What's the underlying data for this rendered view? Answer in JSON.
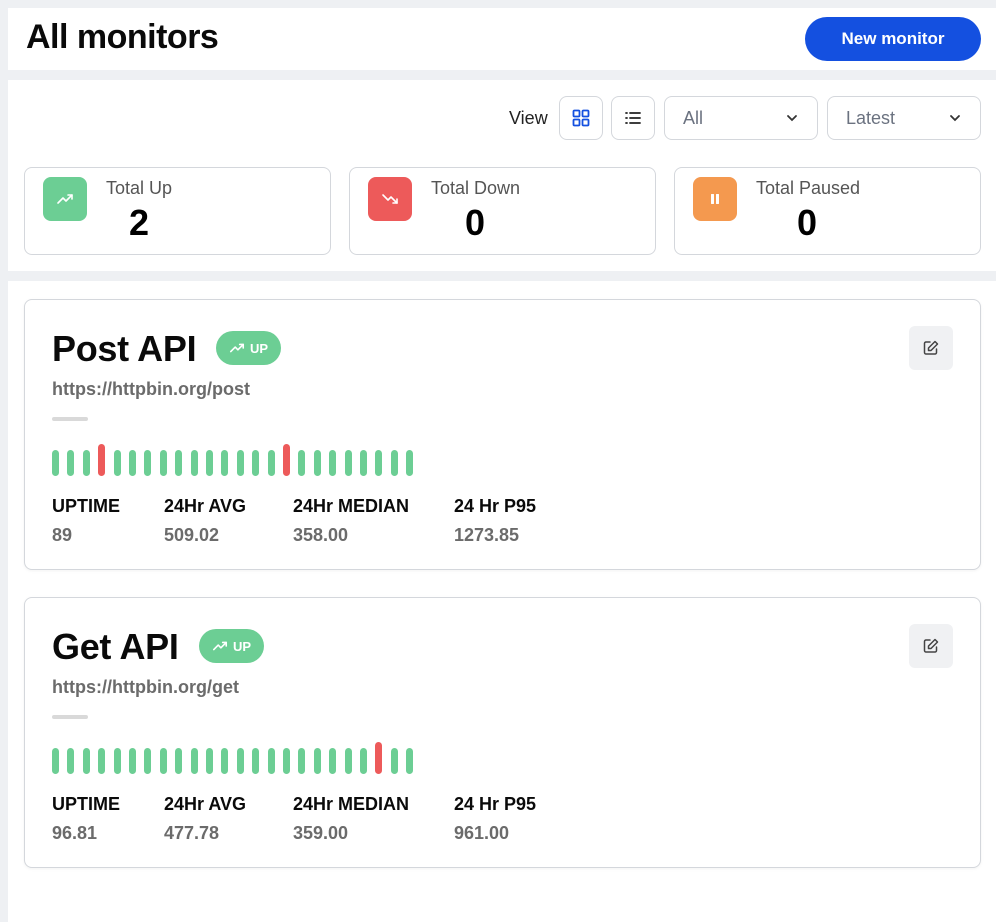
{
  "header": {
    "title": "All monitors",
    "new_monitor_label": "New monitor"
  },
  "toolbar": {
    "view_label": "View",
    "view_modes": [
      "grid-icon",
      "list-icon"
    ],
    "active_view": "grid",
    "status_filter": "All",
    "sort_filter": "Latest"
  },
  "stats": [
    {
      "label": "Total Up",
      "value": "2",
      "icon": "trending-up-icon",
      "color": "#6cce94"
    },
    {
      "label": "Total Down",
      "value": "0",
      "icon": "trending-down-icon",
      "color": "#ed5a5a"
    },
    {
      "label": "Total Paused",
      "value": "0",
      "icon": "pause-icon",
      "color": "#f4994f"
    }
  ],
  "colors": {
    "accent": "#1450e0",
    "up": "#6cce94",
    "down": "#ed5a5a",
    "paused": "#f4994f"
  },
  "monitors": [
    {
      "name": "Post API",
      "status": "UP",
      "url": "https://httpbin.org/post",
      "checks": [
        "up",
        "up",
        "up",
        "down",
        "up",
        "up",
        "up",
        "up",
        "up",
        "up",
        "up",
        "up",
        "up",
        "up",
        "up",
        "down",
        "up",
        "up",
        "up",
        "up",
        "up",
        "up",
        "up",
        "up"
      ],
      "metrics": [
        {
          "label": "UPTIME",
          "value": "89"
        },
        {
          "label": "24Hr AVG",
          "value": "509.02"
        },
        {
          "label": "24Hr MEDIAN",
          "value": "358.00"
        },
        {
          "label": "24 Hr P95",
          "value": "1273.85"
        }
      ]
    },
    {
      "name": "Get API",
      "status": "UP",
      "url": "https://httpbin.org/get",
      "checks": [
        "up",
        "up",
        "up",
        "up",
        "up",
        "up",
        "up",
        "up",
        "up",
        "up",
        "up",
        "up",
        "up",
        "up",
        "up",
        "up",
        "up",
        "up",
        "up",
        "up",
        "up",
        "down",
        "up",
        "up"
      ],
      "metrics": [
        {
          "label": "UPTIME",
          "value": "96.81"
        },
        {
          "label": "24Hr AVG",
          "value": "477.78"
        },
        {
          "label": "24Hr MEDIAN",
          "value": "359.00"
        },
        {
          "label": "24 Hr P95",
          "value": "961.00"
        }
      ]
    }
  ]
}
